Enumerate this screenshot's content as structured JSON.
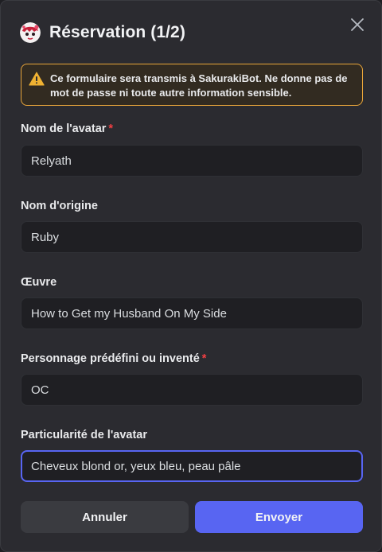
{
  "modal": {
    "title": "Réservation (1/2)",
    "warning": "Ce formulaire sera transmis à SakurakiBot. Ne donne pas de mot de passe ni toute autre information sensible."
  },
  "fields": [
    {
      "label": "Nom de l'avatar",
      "required": "*",
      "value": "Relyath"
    },
    {
      "label": "Nom d'origine",
      "value": "Ruby"
    },
    {
      "label": "Œuvre",
      "value": "How to Get my Husband On My Side"
    },
    {
      "label": "Personnage prédéfini ou inventé",
      "required": "*",
      "value": "OC"
    },
    {
      "label": "Particularité de l'avatar",
      "value": "Cheveux blond or, yeux bleu, peau pâle"
    }
  ],
  "buttons": {
    "cancel": "Annuler",
    "submit": "Envoyer"
  },
  "colors": {
    "accent": "#5865f2",
    "warning": "#e8a53a",
    "required": "#f23f43"
  },
  "icons": {
    "bot_avatar": "sakura-bot-avatar-icon",
    "close": "close-icon",
    "warning": "warning-triangle-icon"
  }
}
